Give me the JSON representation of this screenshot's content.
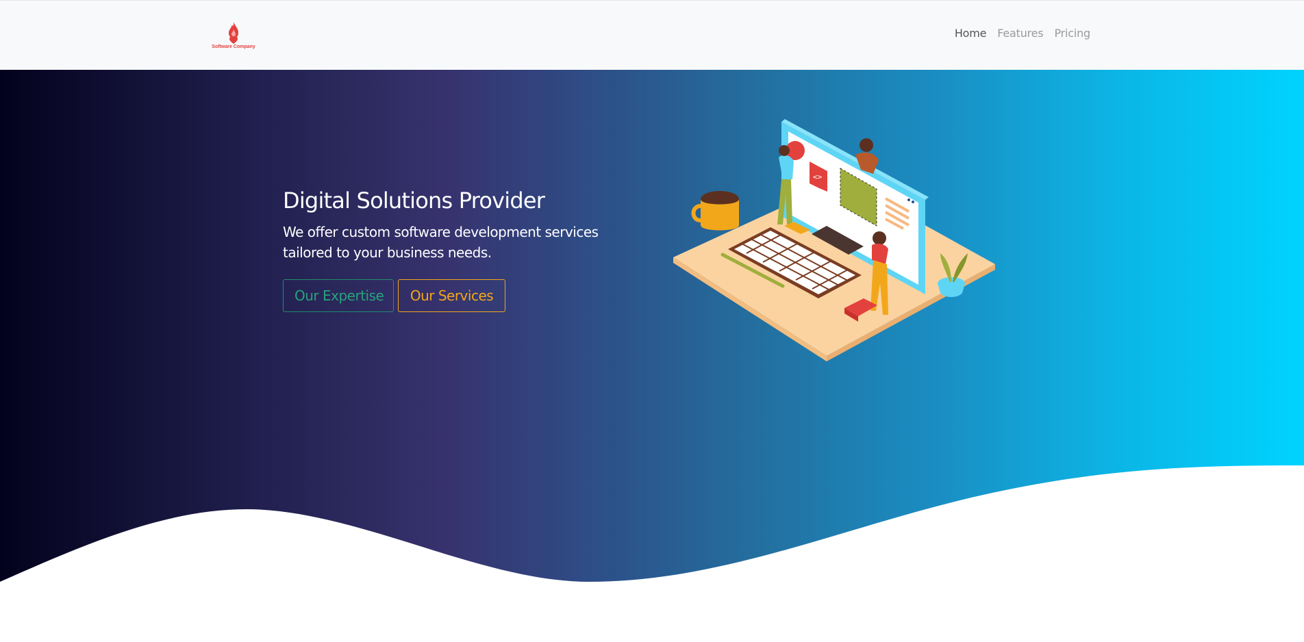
{
  "brand": {
    "name": "Software Company",
    "logo_color": "#e3413d"
  },
  "nav": {
    "items": [
      {
        "label": "Home",
        "active": true
      },
      {
        "label": "Features",
        "active": false
      },
      {
        "label": "Pricing",
        "active": false
      }
    ]
  },
  "hero": {
    "title": "Digital Solutions Provider",
    "subtitle": "We offer custom software development services tailored to your business needs.",
    "buttons": {
      "expertise_label": "Our Expertise",
      "services_label": "Our Services"
    },
    "illustration": "isometric-workspace-illustration"
  },
  "colors": {
    "gradient_start": "#03021d",
    "gradient_mid": "#37326d",
    "gradient_end": "#00d3ff",
    "expertise_button": "#27a37a",
    "services_button": "#f2a71b"
  }
}
